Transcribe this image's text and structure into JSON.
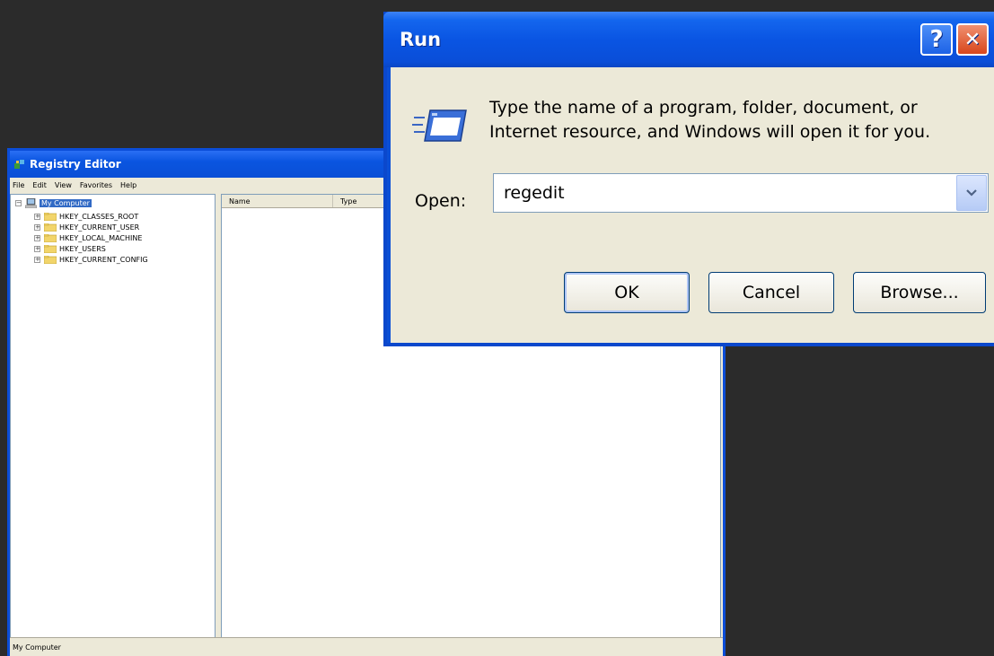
{
  "registry": {
    "title": "Registry Editor",
    "menu": [
      "File",
      "Edit",
      "View",
      "Favorites",
      "Help"
    ],
    "tree": {
      "root": "My Computer",
      "items": [
        "HKEY_CLASSES_ROOT",
        "HKEY_CURRENT_USER",
        "HKEY_LOCAL_MACHINE",
        "HKEY_USERS",
        "HKEY_CURRENT_CONFIG"
      ]
    },
    "columns": [
      "Name",
      "Type"
    ],
    "status": "My Computer"
  },
  "run": {
    "title": "Run",
    "help_glyph": "?",
    "close_glyph": "✕",
    "description_line1": "Type the name of a program, folder, document, or",
    "description_line2": "Internet resource, and Windows will open it for you.",
    "open_label": "Open:",
    "open_value": "regedit",
    "buttons": {
      "ok": "OK",
      "cancel": "Cancel",
      "browse": "Browse..."
    }
  }
}
